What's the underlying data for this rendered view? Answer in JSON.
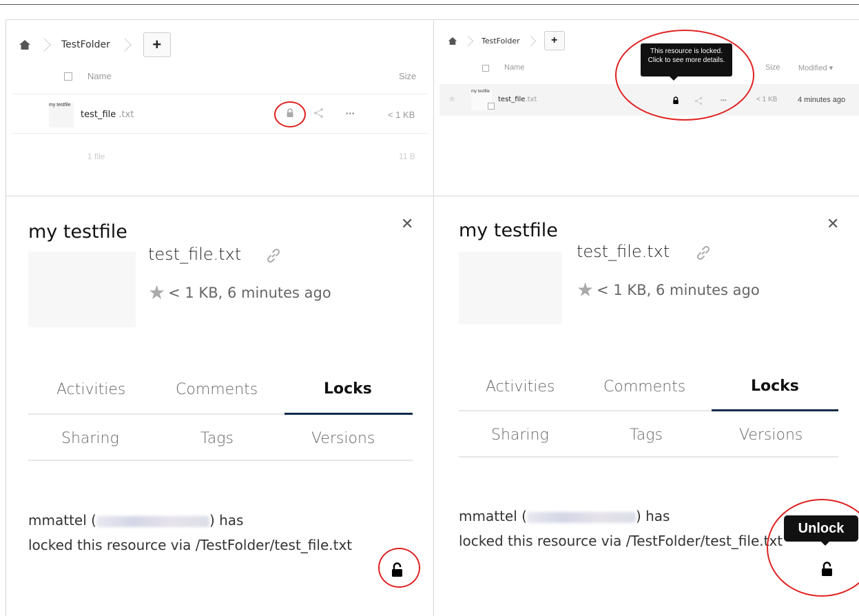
{
  "top_left": {
    "breadcrumb_folder": "TestFolder",
    "new_button": "+",
    "columns": {
      "name": "Name",
      "size": "Size"
    },
    "file": {
      "thumb_label": "my testfile",
      "name": "test_file",
      "ext": " .txt",
      "size": "< 1 KB",
      "more": "•••"
    },
    "summary": {
      "count": "1 file",
      "size": "11 B"
    }
  },
  "top_right": {
    "breadcrumb_folder": "TestFolder",
    "new_button": "+",
    "columns": {
      "name": "Name",
      "size": "Size",
      "modified": "Modified ▾"
    },
    "file": {
      "thumb_label": "my testfile",
      "name": "test_file",
      "ext": ".txt",
      "size": "< 1 KB",
      "modified": "4 minutes ago",
      "more": "•••"
    },
    "tooltip": "This resource is locked. Click to see more details."
  },
  "detail_left": {
    "title": "my testfile",
    "filename": "test_file.txt",
    "meta": "< 1 KB, 6 minutes ago",
    "tabs_row1": [
      "Activities",
      "Comments",
      "Locks"
    ],
    "tabs_row2": [
      "Sharing",
      "Tags",
      "Versions"
    ],
    "lock_user": "mmattel (",
    "lock_user_end": ") has",
    "lock_line2": "locked this resource via /TestFolder/test_file.txt"
  },
  "detail_right": {
    "title": "my testfile",
    "filename": "test_file.txt",
    "meta": "< 1 KB, 6 minutes ago",
    "tabs_row1": [
      "Activities",
      "Comments",
      "Locks"
    ],
    "tabs_row2": [
      "Sharing",
      "Tags",
      "Versions"
    ],
    "lock_user": "mmattel (",
    "lock_user_end": ") has",
    "lock_line2": "locked this resource via /TestFolder/test_file.txt",
    "unlock_tooltip": "Unlock"
  },
  "colors": {
    "accent_line": "#0b2a4a",
    "highlight_ring": "#e02020",
    "tooltip_bg": "#111111"
  }
}
